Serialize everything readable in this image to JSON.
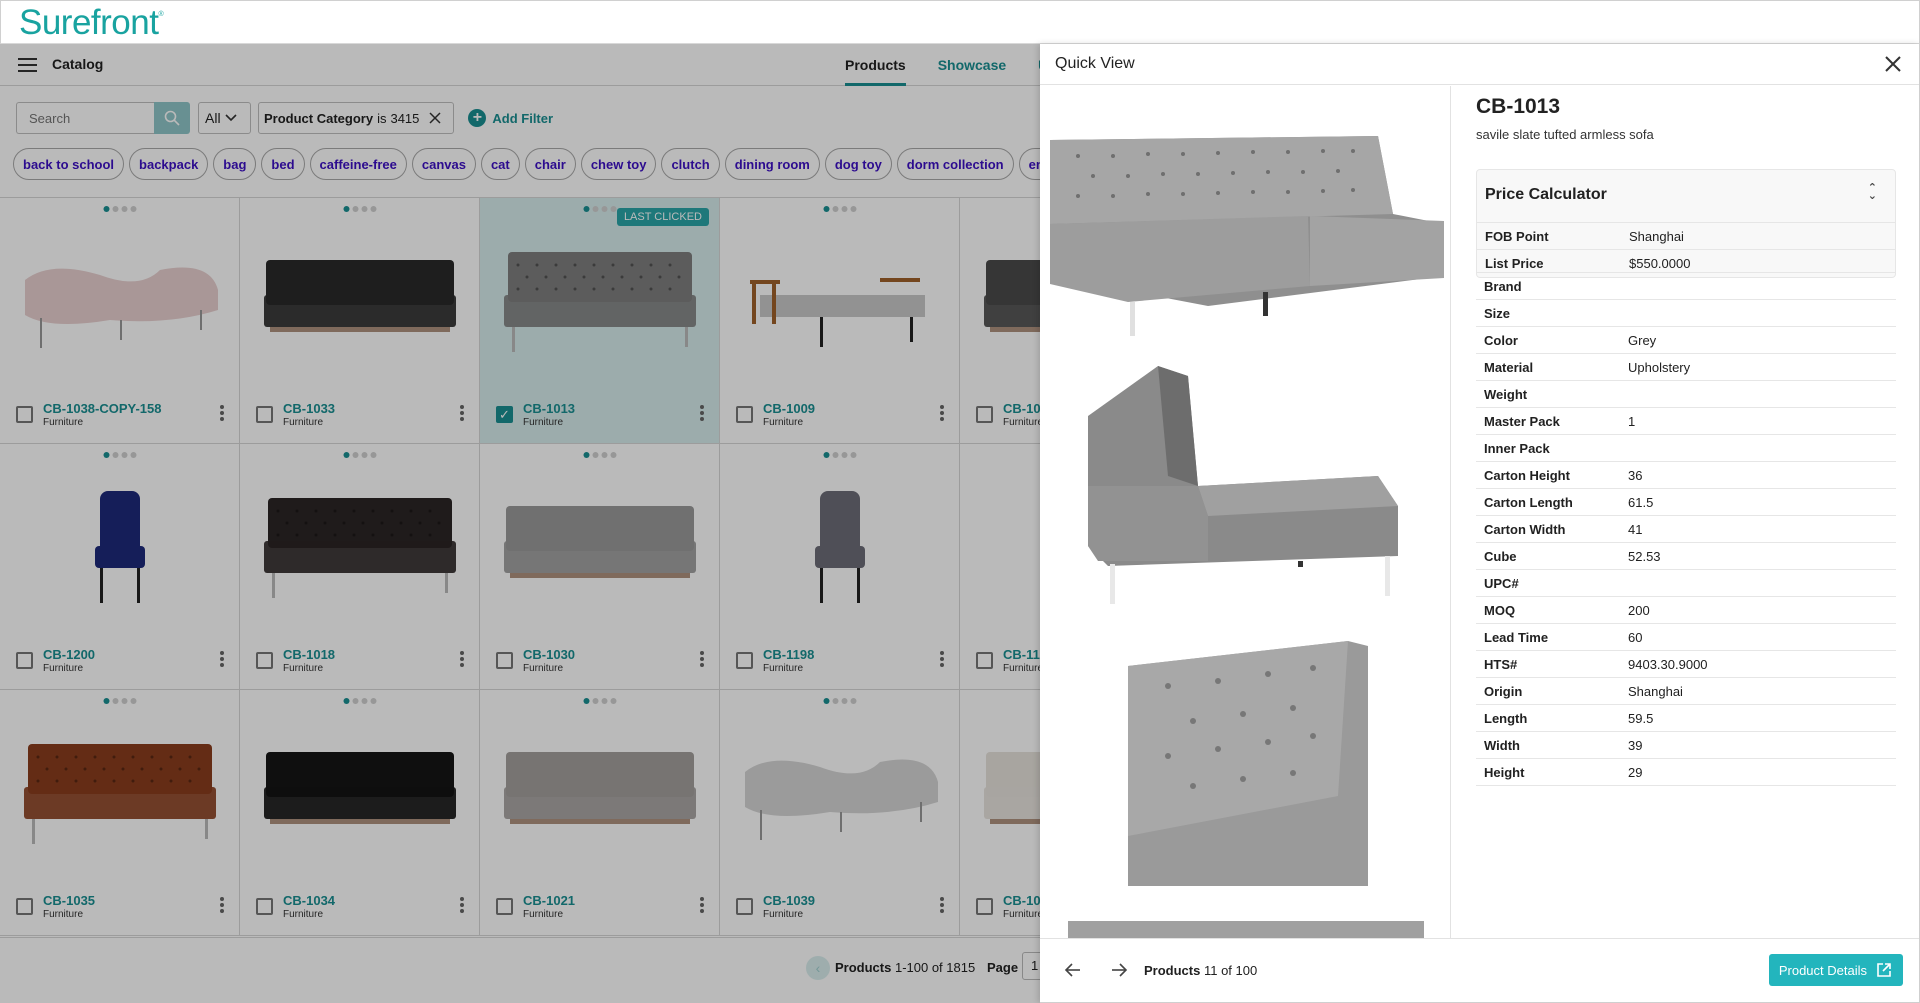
{
  "app": {
    "logo": "Surefront",
    "section": "Catalog"
  },
  "tabs": [
    {
      "label": "Products",
      "active": true
    },
    {
      "label": "Showcase",
      "active": false
    },
    {
      "label": "U",
      "active": false
    }
  ],
  "filters": {
    "search_placeholder": "Search",
    "scope": "All",
    "active_filter": {
      "field": "Product Category",
      "operator": "is",
      "value": "3415"
    },
    "add_filter_label": "Add Filter"
  },
  "tags": [
    "back to school",
    "backpack",
    "bag",
    "bed",
    "caffeine-free",
    "canvas",
    "cat",
    "chair",
    "chew toy",
    "clutch",
    "dining room",
    "dog toy",
    "dorm collection",
    "energy d"
  ],
  "products": [
    {
      "sku": "CB-1038-COPY-158",
      "category": "Furniture",
      "selected": false,
      "last_clicked": false,
      "color": "#e8cfcf",
      "shape": "curvy"
    },
    {
      "sku": "CB-1033",
      "category": "Furniture",
      "selected": false,
      "last_clicked": false,
      "color": "#2a2a2a",
      "shape": "box"
    },
    {
      "sku": "CB-1013",
      "category": "Furniture",
      "selected": true,
      "last_clicked": true,
      "color": "#7e7e7e",
      "shape": "tufted"
    },
    {
      "sku": "CB-1009",
      "category": "Furniture",
      "selected": false,
      "last_clicked": false,
      "color": "#c9c9c9",
      "shape": "daybed"
    },
    {
      "sku": "CB-10",
      "category": "Furniture",
      "selected": false,
      "last_clicked": false,
      "color": "#4a4a4a",
      "shape": "box"
    },
    {
      "sku": "CB-1200",
      "category": "Furniture",
      "selected": false,
      "last_clicked": false,
      "color": "#1d2a7a",
      "shape": "chair"
    },
    {
      "sku": "CB-1018",
      "category": "Furniture",
      "selected": false,
      "last_clicked": false,
      "color": "#2b2525",
      "shape": "tufted"
    },
    {
      "sku": "CB-1030",
      "category": "Furniture",
      "selected": false,
      "last_clicked": false,
      "color": "#9a9a9a",
      "shape": "box"
    },
    {
      "sku": "CB-1198",
      "category": "Furniture",
      "selected": false,
      "last_clicked": false,
      "color": "#6d6d78",
      "shape": "chair"
    },
    {
      "sku": "CB-11",
      "category": "Furniture",
      "selected": false,
      "last_clicked": false,
      "color": "#555555",
      "shape": "chair"
    },
    {
      "sku": "CB-1035",
      "category": "Furniture",
      "selected": false,
      "last_clicked": false,
      "color": "#8a3d1e",
      "shape": "tufted"
    },
    {
      "sku": "CB-1034",
      "category": "Furniture",
      "selected": false,
      "last_clicked": false,
      "color": "#151515",
      "shape": "box"
    },
    {
      "sku": "CB-1021",
      "category": "Furniture",
      "selected": false,
      "last_clicked": false,
      "color": "#a3a09d",
      "shape": "box"
    },
    {
      "sku": "CB-1039",
      "category": "Furniture",
      "selected": false,
      "last_clicked": false,
      "color": "#d5d5d5",
      "shape": "curvy"
    },
    {
      "sku": "CB-10",
      "category": "Furniture",
      "selected": false,
      "last_clicked": false,
      "color": "#e6e2dc",
      "shape": "box"
    }
  ],
  "pagination": {
    "label": "Products",
    "range": "1-100 of 1815",
    "page_label": "Page",
    "page_value": "1"
  },
  "quick_view": {
    "title": "Quick View",
    "sku": "CB-1013",
    "description": "savile slate tufted armless sofa",
    "price_calculator": {
      "title": "Price Calculator",
      "rows": [
        {
          "key": "FOB Point",
          "value": "Shanghai"
        },
        {
          "key": "List Price",
          "value": "$550.0000"
        }
      ]
    },
    "specs": [
      {
        "key": "Brand",
        "value": ""
      },
      {
        "key": "Size",
        "value": ""
      },
      {
        "key": "Color",
        "value": "Grey"
      },
      {
        "key": "Material",
        "value": "Upholstery"
      },
      {
        "key": "Weight",
        "value": ""
      },
      {
        "key": "Master Pack",
        "value": "1"
      },
      {
        "key": "Inner Pack",
        "value": ""
      },
      {
        "key": "Carton Height",
        "value": "36"
      },
      {
        "key": "Carton Length",
        "value": "61.5"
      },
      {
        "key": "Carton Width",
        "value": "41"
      },
      {
        "key": "Cube",
        "value": "52.53"
      },
      {
        "key": "UPC#",
        "value": ""
      },
      {
        "key": "MOQ",
        "value": "200"
      },
      {
        "key": "Lead Time",
        "value": "60"
      },
      {
        "key": "HTS#",
        "value": "9403.30.9000"
      },
      {
        "key": "Origin",
        "value": "Shanghai"
      },
      {
        "key": "Length",
        "value": "59.5"
      },
      {
        "key": "Width",
        "value": "39"
      },
      {
        "key": "Height",
        "value": "29"
      }
    ],
    "footer": {
      "label": "Products",
      "position": "11 of 100",
      "details_button": "Product Details"
    }
  },
  "colors": {
    "accent": "#1a8f92",
    "tag_text": "#3d10c4",
    "button": "#23b5bd",
    "logo": "#19a3a0"
  }
}
